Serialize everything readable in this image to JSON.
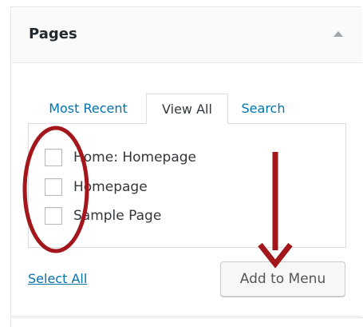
{
  "panel": {
    "title": "Pages",
    "collapse_icon": "triangle-up-icon"
  },
  "tabs": [
    {
      "label": "Most Recent",
      "active": false
    },
    {
      "label": "View All",
      "active": true
    },
    {
      "label": "Search",
      "active": false
    }
  ],
  "pages": [
    {
      "label": "Home: Homepage",
      "checked": false
    },
    {
      "label": "Homepage",
      "checked": false
    },
    {
      "label": "Sample Page",
      "checked": false
    }
  ],
  "actions": {
    "select_all": "Select All",
    "add_to_menu": "Add to Menu"
  },
  "colors": {
    "link": "#0073aa",
    "annotation": "#a3161b",
    "text": "#32373c"
  }
}
